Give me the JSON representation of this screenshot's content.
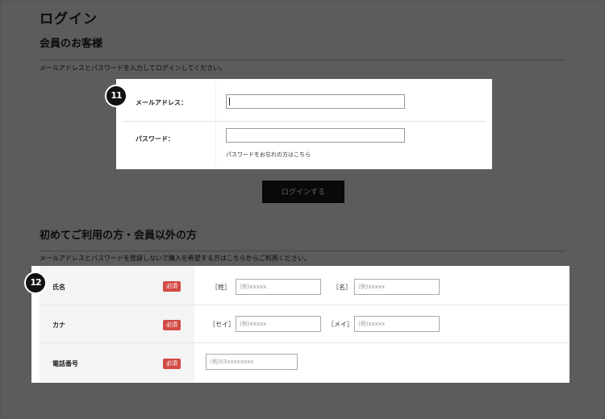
{
  "page_title": "ログイン",
  "member_section": {
    "heading": "会員のお客様",
    "note": "メールアドレスとパスワードを入力してログインしてください。",
    "email_label": "メールアドレス：",
    "password_label": "パスワード：",
    "forgot_link": "パスワードをお忘れの方はこちら",
    "login_button": "ログインする",
    "marker": "11"
  },
  "guest_section": {
    "heading": "初めてご利用の方・会員以外の方",
    "note": "メールアドレスとパスワードを登録しないで購入を希望する方はこちらからご利用ください。",
    "marker": "12",
    "required_badge": "必須",
    "name_row": {
      "label": "氏名",
      "last_bracket": "［姓］",
      "last_placeholder": "(例)xxxxx",
      "first_bracket": "［名］",
      "first_placeholder": "(例)xxxxx"
    },
    "kana_row": {
      "label": "カナ",
      "last_bracket": "［セイ］",
      "last_placeholder": "(例)xxxxx",
      "first_bracket": "［メイ］",
      "first_placeholder": "(例)xxxxx"
    },
    "phone_row": {
      "label": "電話番号",
      "placeholder": "(例)03xxxxxxxx"
    }
  }
}
